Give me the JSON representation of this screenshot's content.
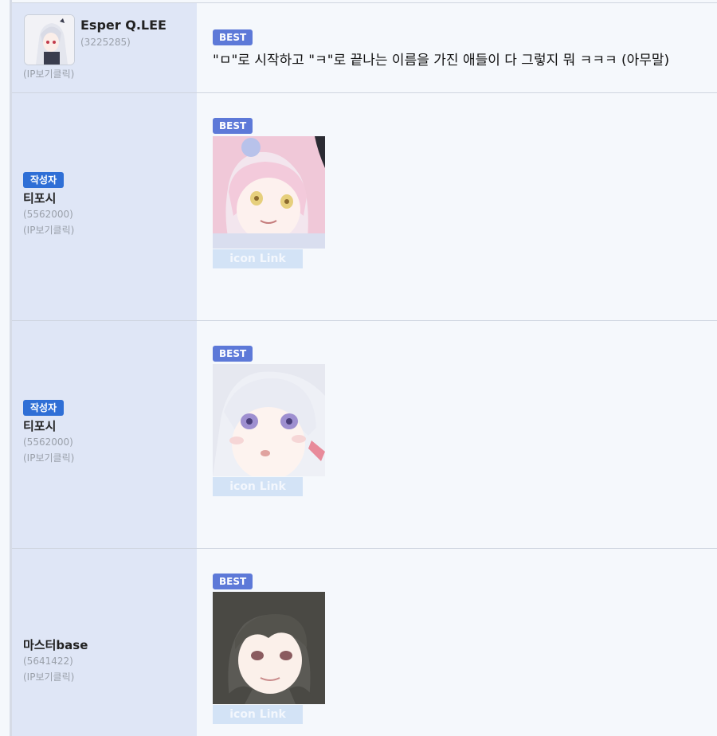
{
  "comments": [
    {
      "author_name": "Esper Q.LEE",
      "author_id": "(3225285)",
      "ip_label": "(IP보기클릭)",
      "best_label": "BEST",
      "text": "\"ㅁ\"로 시작하고 \"ㅋ\"로 끝나는 이름을 가진 애들이 다 그렇지 뭐 ㅋㅋㅋ (아무말)"
    },
    {
      "author_badge": "작성자",
      "author_name": "티포시",
      "author_id": "(5562000)",
      "ip_label": "(IP보기클릭)",
      "best_label": "BEST",
      "icon_link_label": "icon Link",
      "image_icon": "pink-hair-anime-girl"
    },
    {
      "author_badge": "작성자",
      "author_name": "티포시",
      "author_id": "(5562000)",
      "ip_label": "(IP보기클릭)",
      "best_label": "BEST",
      "icon_link_label": "icon Link",
      "image_icon": "white-hair-anime-girl"
    },
    {
      "author_name": "마스터base",
      "author_id": "(5641422)",
      "ip_label": "(IP보기클릭)",
      "best_label": "BEST",
      "icon_link_label": "icon Link",
      "image_icon": "dark-hair-anime-girl"
    }
  ],
  "colors": {
    "author_col_bg": "#dfe6f6",
    "content_bg": "#f5f8fc",
    "best_badge": "#5d79d8",
    "author_badge": "#2f6fd6"
  }
}
